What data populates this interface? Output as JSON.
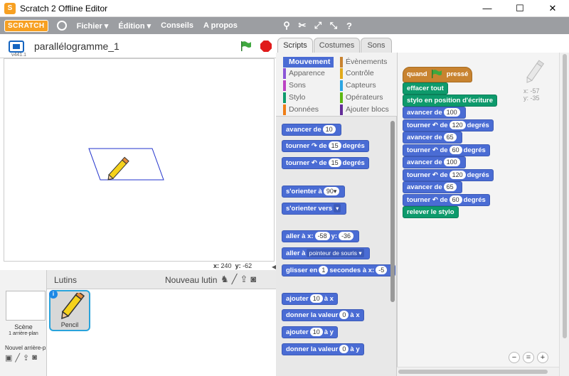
{
  "window": {
    "title": "Scratch 2 Offline Editor"
  },
  "menu": {
    "logo": "SCRATCH",
    "items": [
      "Fichier ▾",
      "Édition ▾",
      "Conseils",
      "A propos"
    ]
  },
  "stage": {
    "project_name": "parallélogramme_1",
    "version": "v441.1",
    "x_label": "x:",
    "x_value": "240",
    "y_label": "y:",
    "y_value": "-62"
  },
  "scene": {
    "label": "Scène",
    "sub": "1 arrière-plan",
    "new_bg": "Nouvel arrière-p"
  },
  "sprites": {
    "header": "Lutins",
    "new_sprite": "Nouveau lutin",
    "items": [
      {
        "name": "Pencil"
      }
    ]
  },
  "tabs": [
    "Scripts",
    "Costumes",
    "Sons"
  ],
  "categories": [
    {
      "label": "Mouvement",
      "color": "#4a6cd4",
      "selected": true
    },
    {
      "label": "Évènements",
      "color": "#c88330"
    },
    {
      "label": "Apparence",
      "color": "#8a55d7"
    },
    {
      "label": "Contrôle",
      "color": "#e1a91a"
    },
    {
      "label": "Sons",
      "color": "#bb42c3"
    },
    {
      "label": "Capteurs",
      "color": "#2ca5e2"
    },
    {
      "label": "Stylo",
      "color": "#0e9a6c"
    },
    {
      "label": "Opérateurs",
      "color": "#5cb712"
    },
    {
      "label": "Données",
      "color": "#ee7d16"
    },
    {
      "label": "Ajouter blocs",
      "color": "#632d99"
    }
  ],
  "palette": {
    "b1": {
      "t": "avancer de",
      "v": "10"
    },
    "b2": {
      "a": "tourner",
      "b": "de",
      "v": "15",
      "c": "degrés"
    },
    "b3": {
      "a": "tourner",
      "b": "de",
      "v": "15",
      "c": "degrés"
    },
    "b4": {
      "t": "s'orienter à",
      "v": "90▾"
    },
    "b5": {
      "t": "s'orienter vers",
      "v": "▾"
    },
    "b6": {
      "a": "aller à x:",
      "v1": "-58",
      "b": "y:",
      "v2": "-36"
    },
    "b7": {
      "t": "aller à",
      "v": "pointeur de souris ▾"
    },
    "b8": {
      "a": "glisser en",
      "v1": "1",
      "b": "secondes à x:",
      "v2": "-5"
    },
    "b9": {
      "a": "ajouter",
      "v": "10",
      "b": "à x"
    },
    "b10": {
      "a": "donner la valeur",
      "v": "0",
      "b": "à x"
    },
    "b11": {
      "a": "ajouter",
      "v": "10",
      "b": "à y"
    },
    "b12": {
      "a": "donner la valeur",
      "v": "0",
      "b": "à y"
    }
  },
  "script": {
    "hat_a": "quand",
    "hat_b": "pressé",
    "s1": "effacer tout",
    "s2": "stylo en position d'écriture",
    "s3": {
      "a": "avancer de",
      "v": "100"
    },
    "s4": {
      "a": "tourner",
      "b": "de",
      "v": "120",
      "c": "degrés"
    },
    "s5": {
      "a": "avancer de",
      "v": "65"
    },
    "s6": {
      "a": "tourner",
      "b": "de",
      "v": "60",
      "c": "degrés"
    },
    "s7": {
      "a": "avancer de",
      "v": "100"
    },
    "s8": {
      "a": "tourner",
      "b": "de",
      "v": "120",
      "c": "degrés"
    },
    "s9": {
      "a": "avancer de",
      "v": "65"
    },
    "s10": {
      "a": "tourner",
      "b": "de",
      "v": "60",
      "c": "degrés"
    },
    "s11": "relever le stylo",
    "x_readout": "x: -57",
    "y_readout": "y: -35"
  },
  "colors": {
    "motion": "#4a6cd4",
    "pen": "#0e9a6c",
    "events": "#c88330",
    "menubar": "#9c9ea2"
  },
  "icons": [
    "scratch-logo-icon",
    "globe-icon",
    "duplicate-icon",
    "cut-icon",
    "grow-icon",
    "shrink-icon",
    "help-icon",
    "green-flag-icon",
    "stop-icon",
    "pencil-icon",
    "paint-icon",
    "camera-icon",
    "upload-icon",
    "zoom-out-icon",
    "zoom-reset-icon",
    "zoom-in-icon"
  ]
}
